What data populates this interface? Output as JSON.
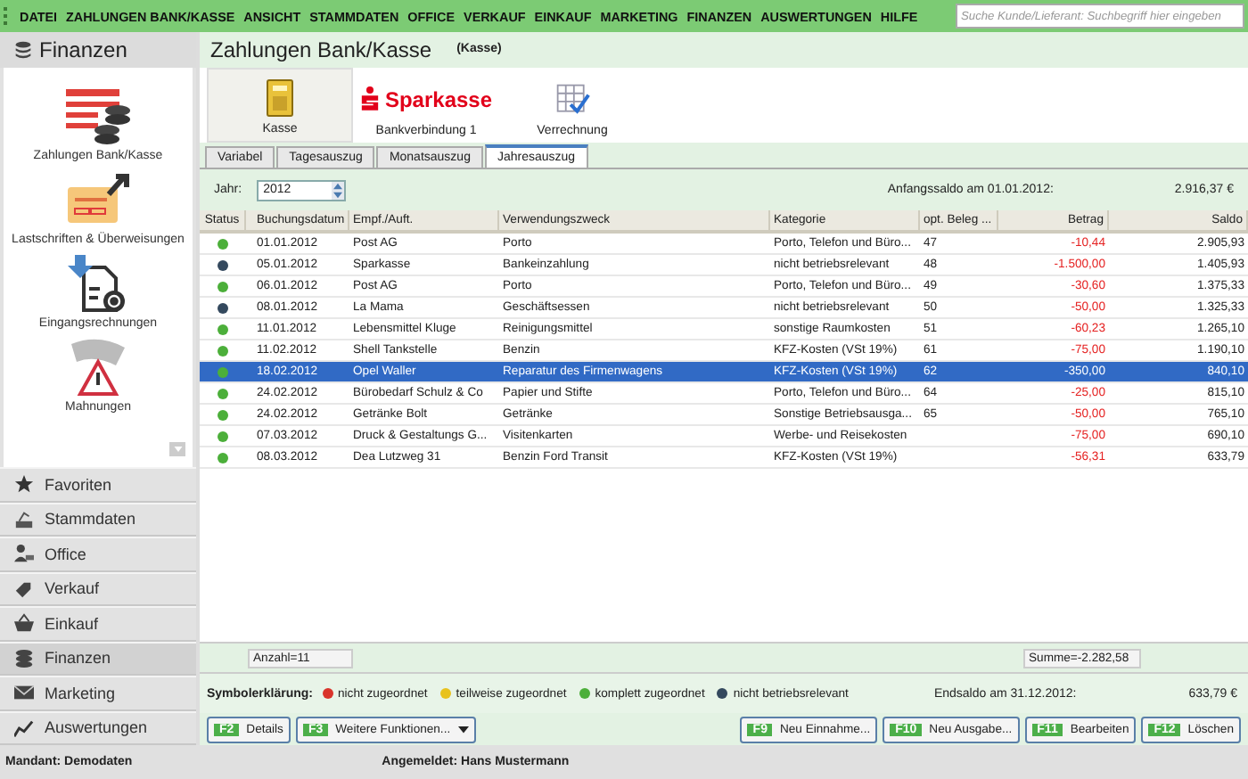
{
  "menu": [
    "DATEI",
    "ZAHLUNGEN BANK/KASSE",
    "ANSICHT",
    "STAMMDATEN",
    "OFFICE",
    "VERKAUF",
    "EINKAUF",
    "MARKETING",
    "FINANZEN",
    "AUSWERTUNGEN",
    "HILFE"
  ],
  "search": {
    "placeholder": "Suche Kunde/Lieferant: Suchbegriff hier eingeben"
  },
  "sidebar": {
    "title": "Finanzen",
    "modules": [
      {
        "kind": "payments",
        "label": "Zahlungen Bank/Kasse"
      },
      {
        "kind": "transfers",
        "label": "Lastschriften & Überweisungen"
      },
      {
        "kind": "invoices",
        "label": "Eingangsrechnungen"
      },
      {
        "kind": "reminders",
        "label": "Mahnungen"
      }
    ],
    "nav": [
      {
        "kind": "star",
        "label": "Favoriten",
        "selected": false
      },
      {
        "kind": "master",
        "label": "Stammdaten",
        "selected": false
      },
      {
        "kind": "office",
        "label": "Office",
        "selected": false
      },
      {
        "kind": "tag",
        "label": "Verkauf",
        "selected": false
      },
      {
        "kind": "basket",
        "label": "Einkauf",
        "selected": false
      },
      {
        "kind": "coins",
        "label": "Finanzen",
        "selected": true
      },
      {
        "kind": "mail",
        "label": "Marketing",
        "selected": false
      },
      {
        "kind": "chart",
        "label": "Auswertungen",
        "selected": false
      }
    ]
  },
  "page": {
    "title": "Zahlungen Bank/Kasse",
    "subtitle": "(Kasse)"
  },
  "accounts": [
    {
      "kind": "cash",
      "label": "Kasse",
      "selected": true
    },
    {
      "kind": "bank",
      "brand": "Sparkasse",
      "label": "Bankverbindung 1",
      "selected": false
    },
    {
      "kind": "clearing",
      "label": "Verrechnung",
      "selected": false
    }
  ],
  "tabs": [
    {
      "label": "Variabel",
      "selected": false
    },
    {
      "label": "Tagesauszug",
      "selected": false
    },
    {
      "label": "Monatsauszug",
      "selected": false
    },
    {
      "label": "Jahresauszug",
      "selected": true
    }
  ],
  "year": {
    "label": "Jahr:",
    "value": "2012"
  },
  "opening": {
    "label": "Anfangssaldo am 01.01.2012:",
    "value": "2.916,37 €"
  },
  "table": {
    "columns": [
      "Status",
      "Buchungsdatum",
      "Empf./Auft.",
      "Verwendungszweck",
      "Kategorie",
      "opt. Beleg ...",
      "Betrag",
      "Saldo"
    ],
    "rows": [
      {
        "color": "#4caf3a",
        "selected": false,
        "cells": [
          "",
          "01.01.2012",
          "Post AG",
          "Porto",
          "Porto, Telefon und Büro...",
          "47",
          "-10,44",
          "2.905,93"
        ]
      },
      {
        "color": "#34495e",
        "selected": false,
        "cells": [
          "",
          "05.01.2012",
          "Sparkasse",
          "Bankeinzahlung",
          "nicht betriebsrelevant",
          "48",
          "-1.500,00",
          "1.405,93"
        ]
      },
      {
        "color": "#4caf3a",
        "selected": false,
        "cells": [
          "",
          "06.01.2012",
          "Post AG",
          "Porto",
          "Porto, Telefon und Büro...",
          "49",
          "-30,60",
          "1.375,33"
        ]
      },
      {
        "color": "#34495e",
        "selected": false,
        "cells": [
          "",
          "08.01.2012",
          "La Mama",
          "Geschäftsessen",
          "nicht betriebsrelevant",
          "50",
          "-50,00",
          "1.325,33"
        ]
      },
      {
        "color": "#4caf3a",
        "selected": false,
        "cells": [
          "",
          "11.01.2012",
          "Lebensmittel Kluge",
          "Reinigungsmittel",
          "sonstige Raumkosten",
          "51",
          "-60,23",
          "1.265,10"
        ]
      },
      {
        "color": "#4caf3a",
        "selected": false,
        "cells": [
          "",
          "11.02.2012",
          "Shell Tankstelle",
          "Benzin",
          "KFZ-Kosten (VSt 19%)",
          "61",
          "-75,00",
          "1.190,10"
        ]
      },
      {
        "color": "#4caf3a",
        "selected": true,
        "cells": [
          "",
          "18.02.2012",
          "Opel Waller",
          "Reparatur des Firmenwagens",
          "KFZ-Kosten (VSt 19%)",
          "62",
          "-350,00",
          "840,10"
        ]
      },
      {
        "color": "#4caf3a",
        "selected": false,
        "cells": [
          "",
          "24.02.2012",
          "Bürobedarf Schulz & Co",
          "Papier und Stifte",
          "Porto, Telefon und Büro...",
          "64",
          "-25,00",
          "815,10"
        ]
      },
      {
        "color": "#4caf3a",
        "selected": false,
        "cells": [
          "",
          "24.02.2012",
          "Getränke Bolt",
          "Getränke",
          "Sonstige Betriebsausga...",
          "65",
          "-50,00",
          "765,10"
        ]
      },
      {
        "color": "#4caf3a",
        "selected": false,
        "cells": [
          "",
          "07.03.2012",
          "Druck & Gestaltungs G...",
          "Visitenkarten",
          "Werbe- und Reisekosten",
          "",
          "-75,00",
          "690,10"
        ]
      },
      {
        "color": "#4caf3a",
        "selected": false,
        "cells": [
          "",
          "08.03.2012",
          "Dea Lutzweg 31",
          "Benzin Ford Transit",
          "KFZ-Kosten (VSt 19%)",
          "",
          "-56,31",
          "633,79"
        ]
      }
    ]
  },
  "count": "Anzahl=11",
  "sum": "Summe=-2.282,58",
  "legend": {
    "title": "Symbolerklärung:",
    "items": [
      {
        "color": "#d9342b",
        "label": "nicht zugeordnet"
      },
      {
        "color": "#e8c21e",
        "label": "teilweise zugeordnet"
      },
      {
        "color": "#4caf3a",
        "label": "komplett zugeordnet"
      },
      {
        "color": "#34495e",
        "label": "nicht betriebsrelevant"
      }
    ]
  },
  "closing": {
    "label": "Endsaldo am 31.12.2012:",
    "value": "633,79 €"
  },
  "buttons_left": [
    {
      "key": "F2",
      "label": "Details",
      "dropdown": false
    },
    {
      "key": "F3",
      "label": "Weitere Funktionen...",
      "dropdown": true
    }
  ],
  "buttons_right": [
    {
      "key": "F9",
      "label": "Neu Einnahme..."
    },
    {
      "key": "F10",
      "label": "Neu Ausgabe..."
    },
    {
      "key": "F11",
      "label": "Bearbeiten"
    },
    {
      "key": "F12",
      "label": "Löschen"
    }
  ],
  "status": {
    "client": "Mandant: Demodaten",
    "user": "Angemeldet: Hans Mustermann"
  }
}
